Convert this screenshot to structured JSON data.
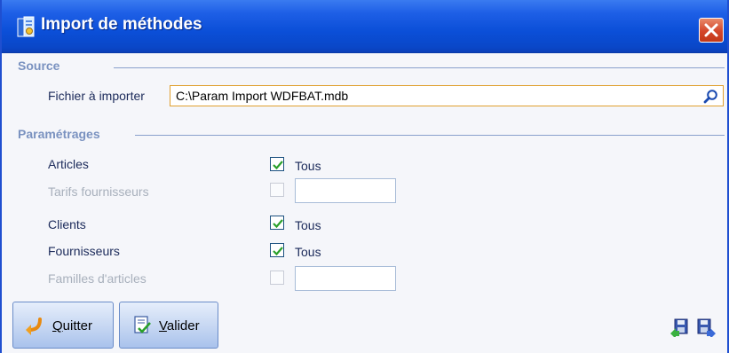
{
  "window": {
    "title": "Import de méthodes",
    "accent": "#0b4fd8"
  },
  "source": {
    "section_title": "Source",
    "file_label": "Fichier à importer",
    "file_value": "C:\\Param Import WDFBAT.mdb"
  },
  "settings": {
    "section_title": "Paramétrages",
    "rows": [
      {
        "label": "Articles",
        "enabled": true,
        "checked": true,
        "option": "Tous"
      },
      {
        "label": "Tarifs fournisseurs",
        "enabled": false,
        "checked": false,
        "option": ""
      },
      {
        "label": "Clients",
        "enabled": true,
        "checked": true,
        "option": "Tous"
      },
      {
        "label": "Fournisseurs",
        "enabled": true,
        "checked": true,
        "option": "Tous"
      },
      {
        "label": "Familles d'articles",
        "enabled": false,
        "checked": false,
        "option": ""
      }
    ]
  },
  "buttons": {
    "quit_first": "Q",
    "quit_rest": "uitter",
    "validate_first": "V",
    "validate_rest": "alider"
  },
  "icons": {
    "app": "report-icon",
    "close": "close-icon",
    "search": "search-icon",
    "quit": "exit-arrow-icon",
    "validate": "validate-doc-icon",
    "save_import": "save-import-icon",
    "save_export": "save-export-icon"
  }
}
